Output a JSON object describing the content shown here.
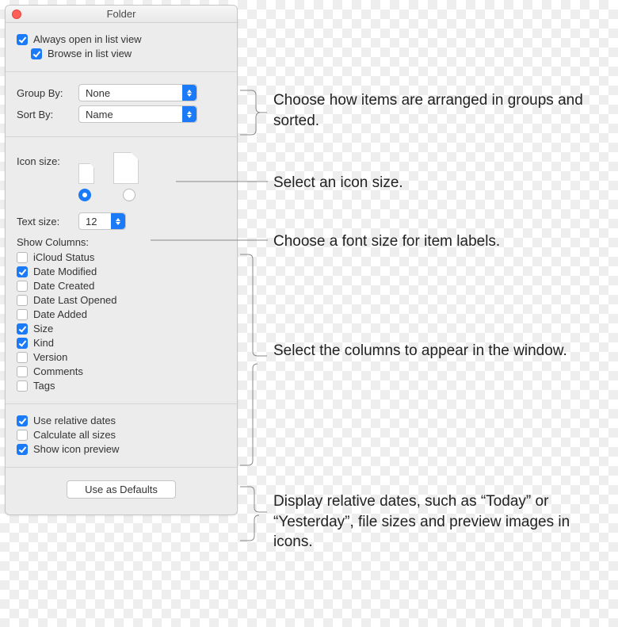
{
  "window": {
    "title": "Folder"
  },
  "top": {
    "always_open": {
      "label": "Always open in list view",
      "checked": true
    },
    "browse": {
      "label": "Browse in list view",
      "checked": true
    }
  },
  "arrange": {
    "group_by_label": "Group By:",
    "group_by_value": "None",
    "sort_by_label": "Sort By:",
    "sort_by_value": "Name"
  },
  "icon": {
    "label": "Icon size:",
    "selected": "small"
  },
  "text": {
    "label": "Text size:",
    "value": "12"
  },
  "columns": {
    "heading": "Show Columns:",
    "items": [
      {
        "label": "iCloud Status",
        "checked": false
      },
      {
        "label": "Date Modified",
        "checked": true
      },
      {
        "label": "Date Created",
        "checked": false
      },
      {
        "label": "Date Last Opened",
        "checked": false
      },
      {
        "label": "Date Added",
        "checked": false
      },
      {
        "label": "Size",
        "checked": true
      },
      {
        "label": "Kind",
        "checked": true
      },
      {
        "label": "Version",
        "checked": false
      },
      {
        "label": "Comments",
        "checked": false
      },
      {
        "label": "Tags",
        "checked": false
      }
    ]
  },
  "footer": {
    "relative_dates": {
      "label": "Use relative dates",
      "checked": true
    },
    "calc_sizes": {
      "label": "Calculate all sizes",
      "checked": false
    },
    "icon_preview": {
      "label": "Show icon preview",
      "checked": true
    }
  },
  "defaults_button": "Use as Defaults",
  "annotations": {
    "arrange": "Choose how items are arranged in groups and sorted.",
    "iconsize": "Select an icon size.",
    "textsize": "Choose a font size for item labels.",
    "columns": "Select the columns to appear in the window.",
    "footer": "Display relative dates, such as “Today” or “Yesterday”, file sizes and preview images in icons."
  }
}
